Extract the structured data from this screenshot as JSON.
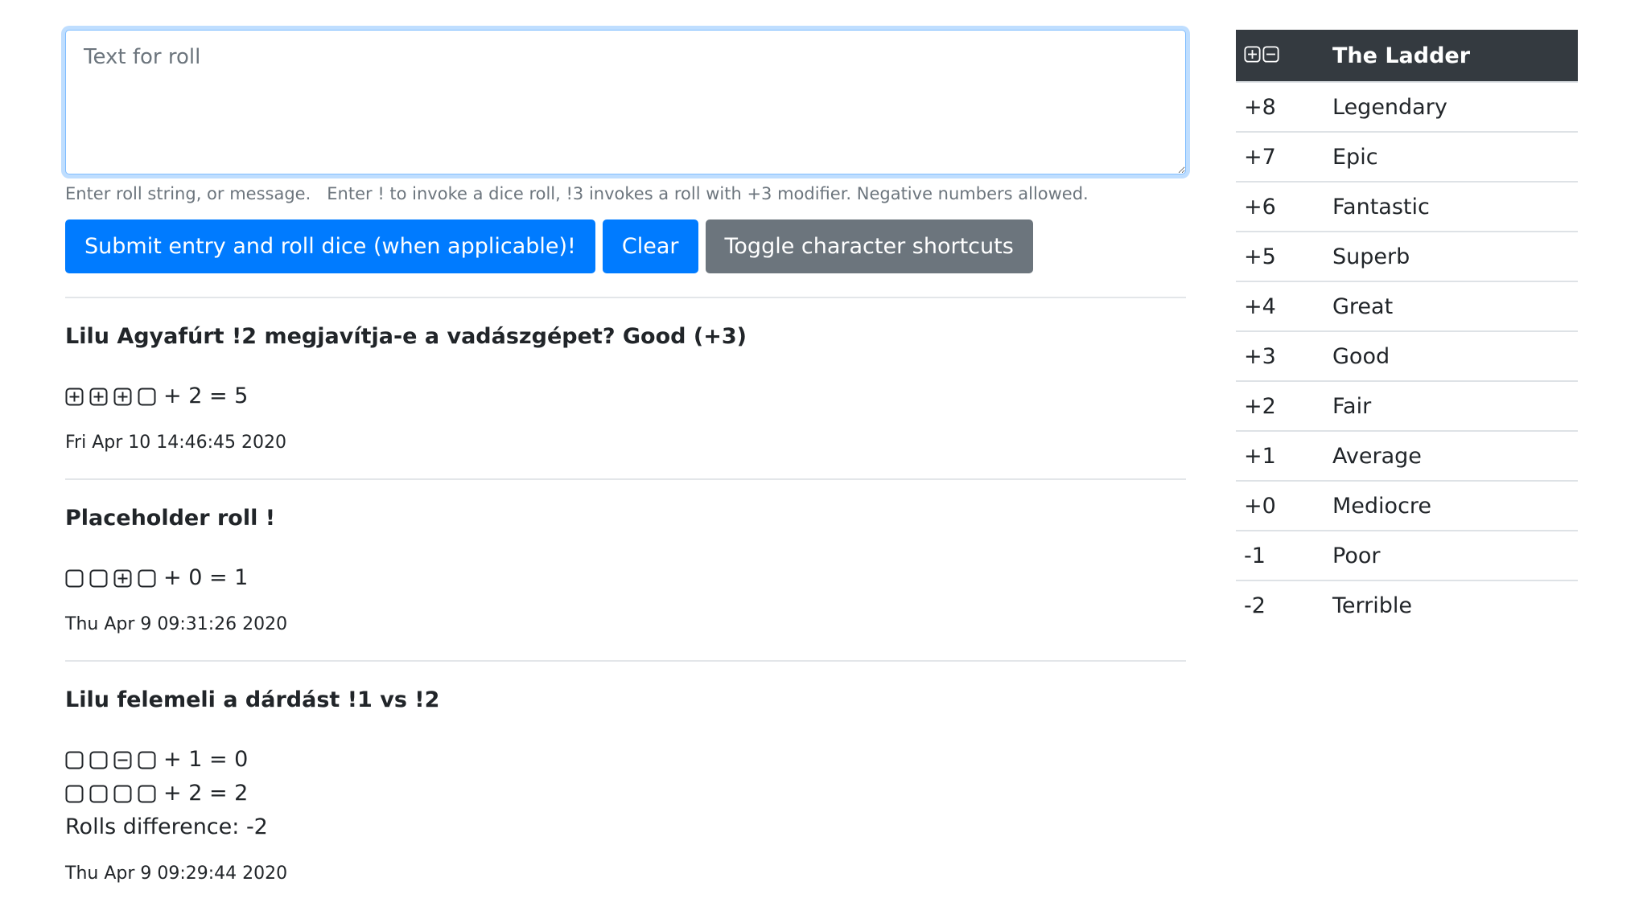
{
  "input": {
    "placeholder": "Text for roll",
    "help": "Enter roll string, or message.   Enter ! to invoke a dice roll, !3 invokes a roll with +3 modifier. Negative numbers allowed."
  },
  "buttons": {
    "submit": "Submit entry and roll dice (when applicable)!",
    "clear": "Clear",
    "toggle": "Toggle character shortcuts"
  },
  "rolls": [
    {
      "title": "Lilu Agyafúrt !2 megjavítja-e a vadászgépet? Good (+3)",
      "lines": [
        {
          "dice": [
            "plus-die-icon",
            "plus-die-icon",
            "plus-die-icon",
            "blank-die-icon"
          ],
          "text": "+ 2 = 5"
        }
      ],
      "difference": "",
      "timestamp": "Fri Apr 10 14:46:45 2020"
    },
    {
      "title": "Placeholder roll !",
      "lines": [
        {
          "dice": [
            "blank-die-icon",
            "blank-die-icon",
            "plus-die-icon",
            "blank-die-icon"
          ],
          "text": "+ 0 = 1"
        }
      ],
      "difference": "",
      "timestamp": "Thu Apr 9 09:31:26 2020"
    },
    {
      "title": "Lilu felemeli a dárdást !1 vs !2",
      "lines": [
        {
          "dice": [
            "blank-die-icon",
            "blank-die-icon",
            "minus-die-icon",
            "blank-die-icon"
          ],
          "text": "+ 1 = 0"
        },
        {
          "dice": [
            "blank-die-icon",
            "blank-die-icon",
            "blank-die-icon",
            "blank-die-icon"
          ],
          "text": "+ 2 = 2"
        }
      ],
      "difference": "Rolls difference: -2",
      "timestamp": "Thu Apr 9 09:29:44 2020"
    }
  ],
  "ladder": {
    "header_icons": [
      "plus-die-icon",
      "minus-die-icon"
    ],
    "title": "The Ladder",
    "rows": [
      {
        "value": "+8",
        "label": "Legendary"
      },
      {
        "value": "+7",
        "label": "Epic"
      },
      {
        "value": "+6",
        "label": "Fantastic"
      },
      {
        "value": "+5",
        "label": "Superb"
      },
      {
        "value": "+4",
        "label": "Great"
      },
      {
        "value": "+3",
        "label": "Good"
      },
      {
        "value": "+2",
        "label": "Fair"
      },
      {
        "value": "+1",
        "label": "Average"
      },
      {
        "value": "+0",
        "label": "Mediocre"
      },
      {
        "value": "-1",
        "label": "Poor"
      },
      {
        "value": "-2",
        "label": "Terrible"
      }
    ]
  },
  "colors": {
    "primary": "#007bff",
    "secondary": "#6c757d",
    "dark": "#343a40",
    "text": "#212529"
  }
}
